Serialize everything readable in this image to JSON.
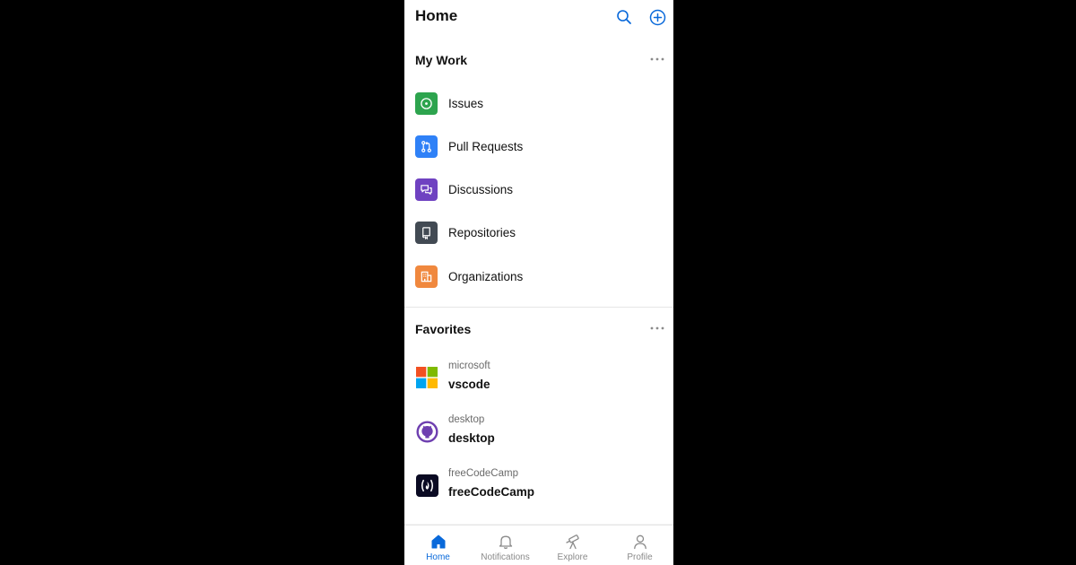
{
  "header": {
    "title": "Home",
    "search_icon": "search-icon",
    "add_icon": "plus-circle-icon"
  },
  "my_work": {
    "title": "My Work",
    "items": [
      {
        "label": "Issues",
        "icon": "issue-opened-icon",
        "color": "#2da44e"
      },
      {
        "label": "Pull Requests",
        "icon": "git-pull-request-icon",
        "color": "#2f81f7"
      },
      {
        "label": "Discussions",
        "icon": "comment-discussion-icon",
        "color": "#6f42c1"
      },
      {
        "label": "Repositories",
        "icon": "repo-icon",
        "color": "#424a53"
      },
      {
        "label": "Organizations",
        "icon": "organization-icon",
        "color": "#f0883e"
      }
    ]
  },
  "favorites": {
    "title": "Favorites",
    "items": [
      {
        "owner": "microsoft",
        "repo": "vscode",
        "icon": "microsoft-logo-icon"
      },
      {
        "owner": "desktop",
        "repo": "desktop",
        "icon": "github-octocat-icon"
      },
      {
        "owner": "freeCodeCamp",
        "repo": "freeCodeCamp",
        "icon": "freecodecamp-logo-icon"
      }
    ]
  },
  "tabs": [
    {
      "label": "Home",
      "icon": "home-icon",
      "active": true
    },
    {
      "label": "Notifications",
      "icon": "bell-icon",
      "active": false
    },
    {
      "label": "Explore",
      "icon": "telescope-icon",
      "active": false
    },
    {
      "label": "Profile",
      "icon": "person-icon",
      "active": false
    }
  ],
  "colors": {
    "accent": "#0969da",
    "text": "#111111",
    "muted": "#6a6a6a"
  }
}
